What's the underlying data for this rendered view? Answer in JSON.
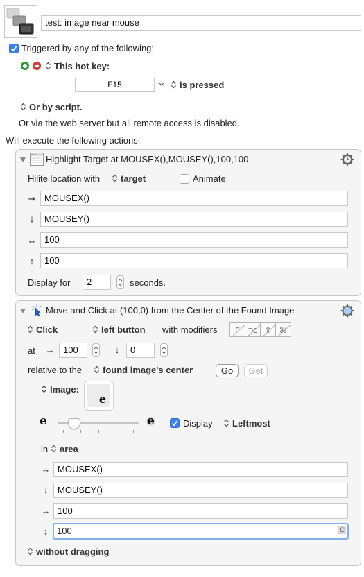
{
  "macro": {
    "icon": "keyboard-stack-icon",
    "name": "test: image near mouse"
  },
  "trigger": {
    "checked": true,
    "label": "Triggered by any of the following:",
    "hotkey_label": "This hot key:",
    "hotkey_value": "F15",
    "hotkey_state": "is pressed",
    "script_label": "Or by script.",
    "web_server_text": "Or via the web server but all remote access is disabled."
  },
  "actions_label": "Will execute the following actions:",
  "action1": {
    "title": "Highlight Target at MOUSEX(),MOUSEY(),100,100",
    "hilite_label": "Hilite location with",
    "hilite_value": "target",
    "animate_label": "Animate",
    "animate_checked": false,
    "x_value": "MOUSEX()",
    "y_value": "MOUSEY()",
    "w_value": "100",
    "h_value": "100",
    "display_for_label": "Display for",
    "display_for_value": "2",
    "seconds_label": "seconds."
  },
  "action2": {
    "title": "Move and Click at (100,0) from the Center of the Found Image",
    "click_value": "Click",
    "button_value": "left button",
    "with_modifiers_label": "with modifiers",
    "modifiers": [
      "⌃",
      "⌥",
      "⇧",
      "⌘"
    ],
    "at_label": "at",
    "x_offset": "100",
    "y_offset": "0",
    "relative_label": "relative to the",
    "relative_value": "found image's center",
    "go_label": "Go",
    "get_label": "Get",
    "image_label": "Image:",
    "image_glyph": "e",
    "fuzz_min_glyph": "e",
    "fuzz_max_glyph": "e",
    "fuzz_level": 0.15,
    "display_label": "Display",
    "display_checked": true,
    "order_value": "Leftmost",
    "in_label": "in",
    "area_value": "area",
    "area_x": "MOUSEX()",
    "area_y": "MOUSEY()",
    "area_w": "100",
    "area_h": "100",
    "field_badge": "C",
    "drag_value": "without dragging"
  }
}
